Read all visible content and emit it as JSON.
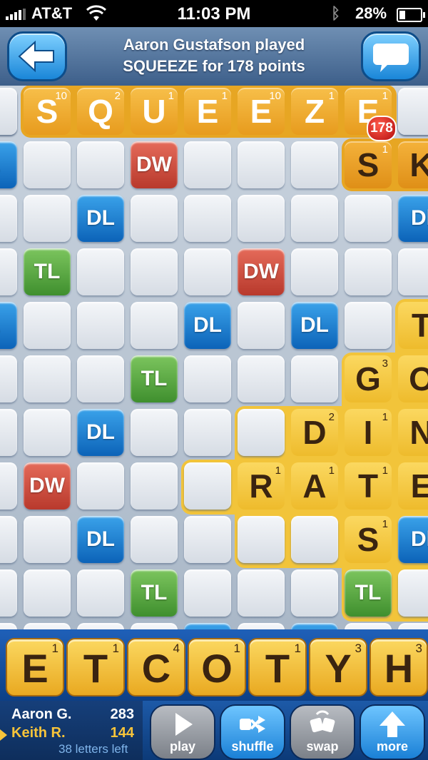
{
  "status": {
    "carrier": "AT&T",
    "time": "11:03 PM",
    "battery": "28%"
  },
  "header": {
    "line1": "Aaron Gustafson played",
    "line2": "SQUEEZE for 178 points"
  },
  "board": {
    "played_word": [
      {
        "letter": "S",
        "points": "10"
      },
      {
        "letter": "Q",
        "points": "2"
      },
      {
        "letter": "U",
        "points": "1"
      },
      {
        "letter": "E",
        "points": "1"
      },
      {
        "letter": "E",
        "points": "10"
      },
      {
        "letter": "Z",
        "points": "1"
      },
      {
        "letter": "E",
        "points": "1"
      }
    ],
    "play_score": "178",
    "tiles": [
      {
        "letter": "S",
        "points": "1"
      },
      {
        "letter": "K",
        "points": ""
      },
      {
        "letter": "T",
        "points": ""
      },
      {
        "letter": "G",
        "points": "3"
      },
      {
        "letter": "O",
        "points": ""
      },
      {
        "letter": "D",
        "points": "2"
      },
      {
        "letter": "I",
        "points": "1"
      },
      {
        "letter": "N",
        "points": ""
      },
      {
        "letter": "R",
        "points": "1"
      },
      {
        "letter": "A",
        "points": "1"
      },
      {
        "letter": "T",
        "points": "1"
      },
      {
        "letter": "E",
        "points": ""
      },
      {
        "letter": "S",
        "points": "1"
      }
    ],
    "bonus_labels": {
      "DW": "DW",
      "TL": "TL",
      "DL": "DL",
      "L": "L",
      "Dl": "Dl"
    }
  },
  "rack": [
    {
      "letter": "E",
      "points": "1"
    },
    {
      "letter": "T",
      "points": "1"
    },
    {
      "letter": "C",
      "points": "4"
    },
    {
      "letter": "O",
      "points": "1"
    },
    {
      "letter": "T",
      "points": "1"
    },
    {
      "letter": "Y",
      "points": "3"
    },
    {
      "letter": "H",
      "points": "3"
    }
  ],
  "players": [
    {
      "name": "Aaron G.",
      "score": "283"
    },
    {
      "name": "Keith R.",
      "score": "144"
    }
  ],
  "letters_left": "38 letters left",
  "buttons": {
    "play": "play",
    "shuffle": "shuffle",
    "swap": "swap",
    "more": "more"
  },
  "colors": {
    "played_tile": "#e79b1d",
    "tile": "#eebb2c",
    "dw": "#b8392c",
    "tl": "#3f8f2e",
    "dl": "#0c63b8"
  }
}
